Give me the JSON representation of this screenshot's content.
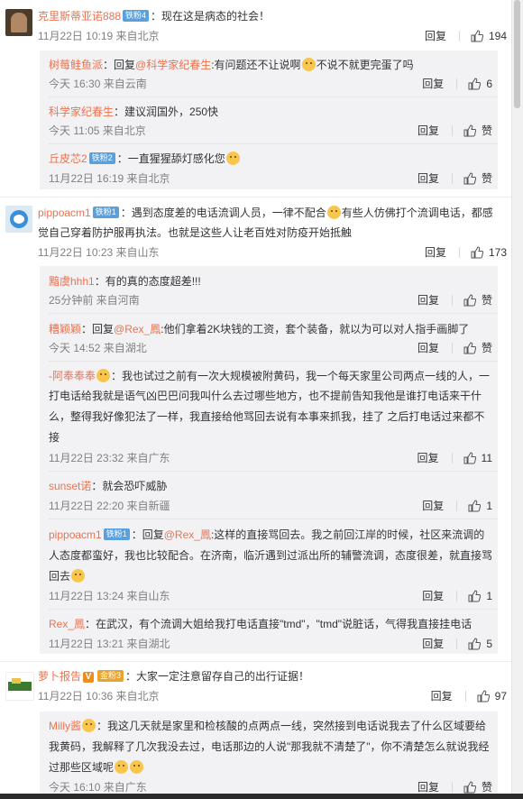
{
  "comments": [
    {
      "user": "克里斯蒂亚诺888",
      "badge": "铁粉4",
      "text": "：现在这是病态的社会！",
      "time": "11月22日 10:19 来自北京",
      "reply": "回复",
      "likes": "194",
      "replies": [
        {
          "user": "树莓鲑鱼派",
          "prefix": "：回复",
          "mention": "@科学家纪春生",
          "text": ":有问题还不让说啊",
          "text2": "不说不就更完蛋了吗",
          "time": "今天 16:30 来自云南",
          "reply": "回复",
          "likes": "6"
        },
        {
          "user": "科学家纪春生",
          "text": "：建议润国外，250快",
          "time": "今天 11:05 来自北京",
          "reply": "回复",
          "likes": "赞"
        },
        {
          "user": "丘皮芯2",
          "badge": "铁粉2",
          "text": "：一直猩猩舔灯感化您",
          "time": "11月22日 16:19 来自北京",
          "reply": "回复",
          "likes": "赞"
        }
      ]
    },
    {
      "user": "pippoacm1",
      "badge": "铁粉1",
      "text_line1": "：遇到态度差的电话流调人员，一律不配合",
      "text_line1b": "有些人仿佛打个流调电话，都感",
      "text_line2": "觉自己穿着防护服再执法。也就是这些人让老百姓对防疫开始抵触",
      "time": "11月22日 10:23 来自山东",
      "reply": "回复",
      "likes": "173",
      "replies": [
        {
          "user": "黯虞hhh1",
          "text": "：有的真的态度超差!!!",
          "time": "25分钟前 来自河南",
          "reply": "回复",
          "likes": "赞"
        },
        {
          "user": "糟颖颖",
          "prefix": "：回复",
          "mention": "@Rex_鳳",
          "text": ":他们拿着2K块钱的工资，套个装备，就以为可以对人指手画脚了",
          "time": "今天 14:52 来自湖北",
          "reply": "回复",
          "likes": "赞"
        },
        {
          "user": "-阿奉奉奉",
          "lines": [
            "：我也试过之前有一次大规模被附黄码，我一个每天家里公司两点一线的人，一",
            "打电话给我就是语气凶巴巴问我叫什么去过哪些地方，也不提前告知我他是谁打电话来干什",
            "么，整得我好像犯法了一样，我直接给他骂回去说有本事来抓我，挂了 之后打电话过来都不",
            "接"
          ],
          "time": "11月22日 23:32 来自广东",
          "reply": "回复",
          "likes": "11"
        },
        {
          "user": "sunset诺",
          "text": "：就会恐吓威胁",
          "time": "11月22日 22:20 来自新疆",
          "reply": "回复",
          "likes": "1"
        },
        {
          "user": "pippoacm1",
          "badge": "铁粉1",
          "prefix": "：回复",
          "mention": "@Rex_鳳",
          "lines": [
            ":这样的直接骂回去。我之前回江岸的时候，社区来流调的",
            "人态度都蛮好，我也比较配合。在济南，临沂遇到过派出所的辅警流调，态度很差，就直接骂",
            "回去"
          ],
          "time": "11月22日 13:24 来自山东",
          "reply": "回复",
          "likes": "1"
        },
        {
          "user": "Rex_鳳",
          "text": "：在武汉，有个流调大姐给我打电话直接\"tmd\"，\"tmd\"说脏话，气得我直接挂电话",
          "time": "11月22日 13:21 来自湖北",
          "reply": "回复",
          "likes": "5"
        }
      ]
    },
    {
      "user": "萝卜报告",
      "badge": "金粉3",
      "text": "：大家一定注意留存自己的出行证据！",
      "time": "11月22日 10:36 来自北京",
      "reply": "回复",
      "likes": "97",
      "replies": [
        {
          "user": "Milly酱",
          "lines": [
            "：我这几天就是家里和检核酸的点两点一线，突然接到电话说我去了什么区域要给",
            "我黄码，我解释了几次我没去过，电话那边的人说\"那我就不清楚了\"，你不清楚怎么就说我经",
            "过那些区域呢"
          ],
          "time": "今天 16:10 来自广东",
          "reply": "回复",
          "likes": "赞"
        }
      ]
    }
  ],
  "colors": {
    "username": "#eb7350",
    "meta": "#808080",
    "reply_bg": "#f2f2f5",
    "badge_blue": "#5aa0dc",
    "badge_gold": "#e8a331"
  }
}
